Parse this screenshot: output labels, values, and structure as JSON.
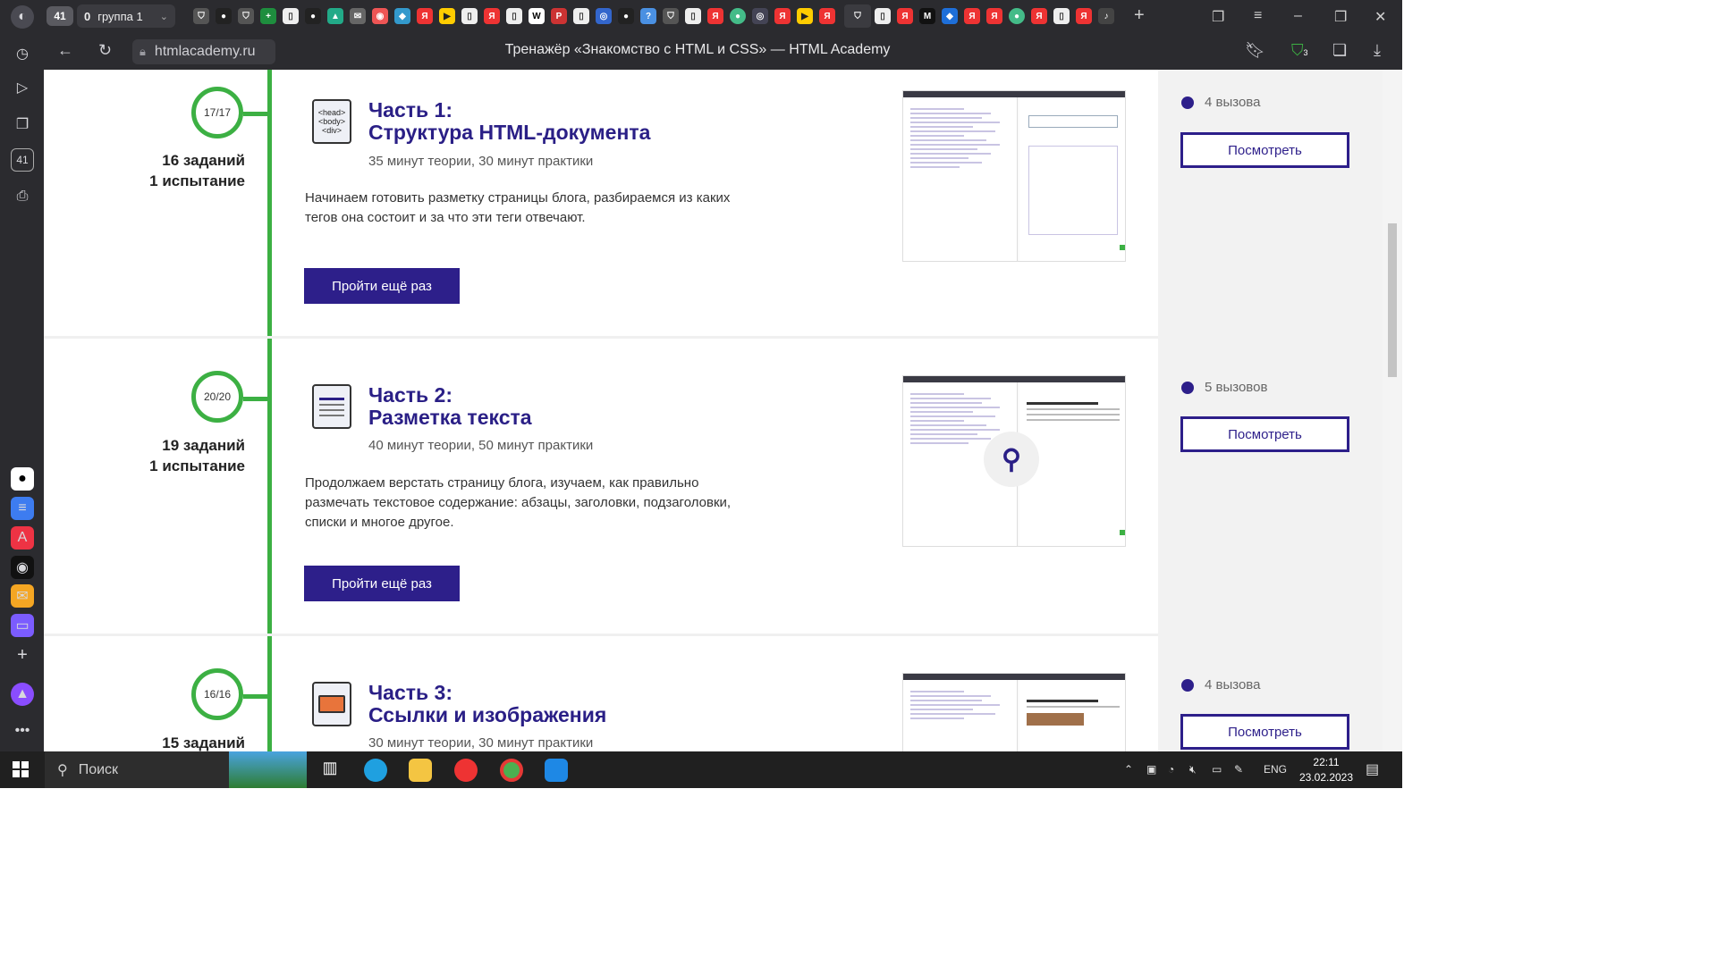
{
  "browser": {
    "tab_count": "41",
    "group": {
      "count": "0",
      "label": "группа 1"
    },
    "url": "htmlacademy.ru",
    "page_title": "Тренажёр «Знакомство с HTML и CSS» — HTML Academy",
    "extension_badge": "3"
  },
  "side_rail": {
    "tab_count": "41"
  },
  "parts": [
    {
      "progress": "17/17",
      "tasks": "16 заданий",
      "trials": "1 испытание",
      "icon_lines": [
        "<head>",
        "<body>",
        "<div>"
      ],
      "title_line1": "Часть 1:",
      "title_line2": "Структура HTML-документа",
      "meta": "35 минут теории, 30 минут практики",
      "description": "Начинаем готовить разметку страницы блога, разбираемся из каких тегов она состоит и за что эти теги отвечают.",
      "button": "Пройти ещё раз",
      "challenges": "4 вызова",
      "view_button": "Посмотреть"
    },
    {
      "progress": "20/20",
      "tasks": "19 заданий",
      "trials": "1 испытание",
      "title_line1": "Часть 2:",
      "title_line2": "Разметка текста",
      "meta": "40 минут теории, 50 минут практики",
      "description": "Продолжаем верстать страницу блога, изучаем, как правильно размечать текстовое содержание: абзацы, заголовки, подзаголовки, списки и многое другое.",
      "button": "Пройти ещё раз",
      "challenges": "5 вызовов",
      "view_button": "Посмотреть"
    },
    {
      "progress": "16/16",
      "tasks": "15 заданий",
      "title_line1": "Часть 3:",
      "title_line2": "Ссылки и изображения",
      "meta": "30 минут теории, 30 минут практики",
      "challenges": "4 вызова",
      "view_button": "Посмотреть"
    }
  ],
  "taskbar": {
    "search_placeholder": "Поиск",
    "lang": "ENG",
    "time": "22:11",
    "date": "23.02.2023"
  },
  "colors": {
    "accent": "#2d1f8a",
    "green": "#3cb043",
    "chrome": "#2b2b2f"
  }
}
